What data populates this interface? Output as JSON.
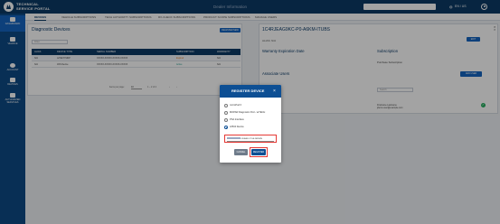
{
  "header": {
    "brand_line1": "TECHNICAL",
    "brand_line2": "SERVICE PORTAL",
    "center_title": "Dealer Information",
    "search_placeholder": "",
    "language": "EN / US",
    "globe_icon": "globe-icon",
    "user_icon": "user-icon",
    "colors": {
      "bar": "#0b3a67",
      "sidebar": "#0d4a86",
      "accent": "#1565c0"
    }
  },
  "sidebar": {
    "items": [
      {
        "label": "DASHBOARD",
        "icon": "dashboard-icon"
      },
      {
        "label": "VEHICLE",
        "icon": "car-icon"
      },
      {
        "label": "ACCOUNT",
        "icon": "account-icon"
      },
      {
        "label": "DEVICES",
        "icon": "devices-icon"
      },
      {
        "label": "AUTHORIZED SERVICES",
        "icon": "services-icon"
      }
    ]
  },
  "tabs": [
    "DEVICES",
    "VEHICLE SUBSCRIPTIONS",
    "TECH AUTHORITY SUBSCRIPTIONS",
    "RX-CHECK SUBSCRIPTIONS",
    "PRODUCT SCOPE SUBSCRIPTIONS",
    "MANAGE USERS"
  ],
  "diagnostic_devices": {
    "title": "Diagnostic Devices",
    "register_button": "REGISTER NEW DEVICE",
    "filter_placeholder": "Filter",
    "columns": [
      "ALIAS",
      "DEVICE TYPE",
      "SERIAL NUMBER",
      "SUBSCRIPTION",
      "WARRANTY"
    ],
    "rows": [
      {
        "alias": "N/A",
        "type": "wiTECH MDP",
        "serial": "XXXXX-XXXXX-XXXXX-XXXXX",
        "subscription": "Expired",
        "warranty": "N/A"
      },
      {
        "alias": "N/A",
        "type": "JDS Device",
        "serial": "XXXXX-XXXXX-XXXXX-XXXXX",
        "subscription": "Active",
        "warranty": "N/A"
      }
    ],
    "pager": {
      "items_per_page_label": "Items per page:",
      "items_per_page": "10",
      "range": "1 – 2 of 2",
      "prev": "‹",
      "next": "›"
    }
  },
  "detail": {
    "vin": "1C4RJEAG9KC-P0-A6KM-ITUBS",
    "close": "×",
    "alias": "ALIAS: N/A",
    "edit_button": "EDIT",
    "warranty_label": "Warranty Expiration Date",
    "subscription_label": "Subscription",
    "subscription_value": "Purchase Subscription",
    "associate_label": "Associate Users",
    "add_user_button": "ADD USER",
    "search_placeholder": "Search",
    "user_name": "Firstname Lastname",
    "user_email": "jdemo.user@example.com"
  },
  "modal": {
    "title": "REGISTER DEVICE",
    "close": "×",
    "options": [
      {
        "label": "microPod II",
        "selected": false
      },
      {
        "label": "MOPAR Diagnostic Pod - wiTECH",
        "selected": false
      },
      {
        "label": "PSA Interface",
        "selected": false
      },
      {
        "label": "J2534 Device",
        "selected": true
      }
    ],
    "serial_prefix": "",
    "serial_suffix": "-CERAN-OTGE-NNNNN",
    "cancel_button": "CANCEL",
    "register_button": "REGISTER"
  }
}
